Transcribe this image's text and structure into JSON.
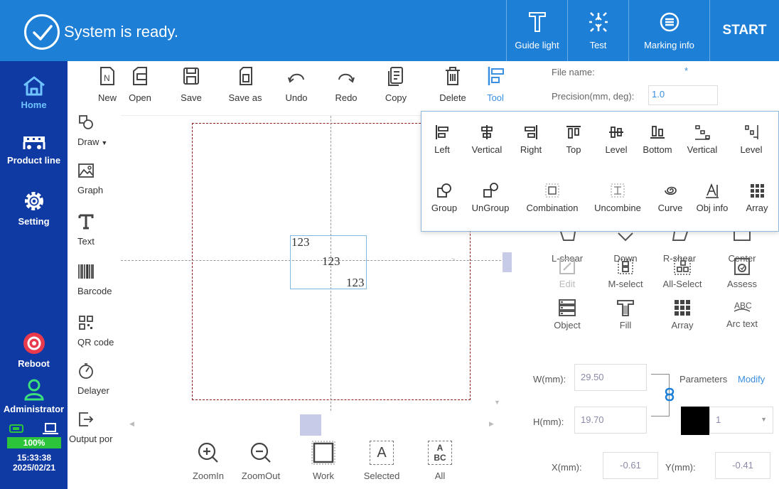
{
  "header": {
    "status_text": "System is ready.",
    "buttons": [
      {
        "label": "Guide light",
        "icon": "guide-light-icon"
      },
      {
        "label": "Test",
        "icon": "test-icon"
      },
      {
        "label": "Marking info",
        "icon": "marking-info-icon"
      }
    ],
    "start_label": "START",
    "color": "#1e7fd6"
  },
  "sidebar": {
    "color": "#0f3aa3",
    "items": [
      {
        "label": "Home",
        "icon": "home-icon"
      },
      {
        "label": "Product line",
        "icon": "product-line-icon"
      },
      {
        "label": "Setting",
        "icon": "gear-icon"
      },
      {
        "label": "Reboot",
        "icon": "reboot-icon"
      },
      {
        "label": "Administrator",
        "icon": "user-icon"
      }
    ],
    "battery": "100%",
    "time": "15:33:38",
    "date": "2025/02/21"
  },
  "toolcol": {
    "items": [
      {
        "label": "Draw",
        "icon": "draw-icon"
      },
      {
        "label": "Graph",
        "icon": "graph-icon"
      },
      {
        "label": "Text",
        "icon": "text-icon"
      },
      {
        "label": "Barcode",
        "icon": "barcode-icon"
      },
      {
        "label": "QR code",
        "icon": "qr-code-icon"
      },
      {
        "label": "Delayer",
        "icon": "delayer-icon"
      },
      {
        "label": "Output por",
        "icon": "output-port-icon"
      }
    ]
  },
  "toolbar": {
    "items": [
      {
        "label": "New",
        "icon": "new-file-icon"
      },
      {
        "label": "Open",
        "icon": "open-icon"
      },
      {
        "label": "Save",
        "icon": "save-icon"
      },
      {
        "label": "Save as",
        "icon": "save-as-icon"
      },
      {
        "label": "Undo",
        "icon": "undo-icon"
      },
      {
        "label": "Redo",
        "icon": "redo-icon"
      },
      {
        "label": "Copy",
        "icon": "copy-icon"
      },
      {
        "label": "Delete",
        "icon": "delete-icon"
      },
      {
        "label": "Tool",
        "icon": "tool-icon"
      }
    ]
  },
  "file": {
    "name_label": "File name:",
    "name_value": "*",
    "precision_label": "Precision(mm, deg):",
    "precision_value": "1.0"
  },
  "canvas": {
    "texts": [
      "123",
      "123",
      "123"
    ]
  },
  "align_popup": {
    "row1": [
      {
        "label": "Left",
        "icon": "align-left-icon"
      },
      {
        "label": "Vertical",
        "icon": "align-vertical-center-icon"
      },
      {
        "label": "Right",
        "icon": "align-right-icon"
      },
      {
        "label": "Top",
        "icon": "align-top-icon"
      },
      {
        "label": "Level",
        "icon": "align-level-center-icon"
      },
      {
        "label": "Bottom",
        "icon": "align-bottom-icon"
      },
      {
        "label": "Vertical",
        "icon": "distribute-vertical-icon"
      },
      {
        "label": "Level",
        "icon": "distribute-level-icon"
      }
    ],
    "row2": [
      {
        "label": "Group",
        "icon": "group-icon"
      },
      {
        "label": "UnGroup",
        "icon": "ungroup-icon"
      },
      {
        "label": "Combination",
        "icon": "combination-icon"
      },
      {
        "label": "Uncombine",
        "icon": "uncombine-icon"
      },
      {
        "label": "Curve",
        "icon": "curve-icon"
      },
      {
        "label": "Obj info",
        "icon": "obj-info-icon"
      },
      {
        "label": "Array",
        "icon": "array-icon"
      }
    ]
  },
  "right_panel": {
    "row1": [
      {
        "label": "L-shear"
      },
      {
        "label": "Down"
      },
      {
        "label": "R-shear"
      },
      {
        "label": "Center"
      }
    ],
    "row2": [
      {
        "label": "Edit",
        "icon": "edit-icon"
      },
      {
        "label": "M-select",
        "icon": "m-select-icon"
      },
      {
        "label": "All-Select",
        "icon": "all-select-icon"
      },
      {
        "label": "Assess",
        "icon": "assess-icon"
      }
    ],
    "row3": [
      {
        "label": "Object",
        "icon": "object-icon"
      },
      {
        "label": "Fill",
        "icon": "fill-icon"
      },
      {
        "label": "Array",
        "icon": "array-icon"
      },
      {
        "label": "Arc text",
        "icon": "arc-text-icon"
      }
    ],
    "w_label": "W(mm):",
    "w_value": "29.50",
    "h_label": "H(mm):",
    "h_value": "19.70",
    "x_label": "X(mm):",
    "x_value": "-0.61",
    "y_label": "Y(mm):",
    "y_value": "-0.41",
    "parameters_label": "Parameters",
    "modify_label": "Modify",
    "layer_value": "1"
  },
  "zoombar": {
    "items": [
      {
        "label": "ZoomIn",
        "icon": "zoom-in-icon"
      },
      {
        "label": "ZoomOut",
        "icon": "zoom-out-icon"
      },
      {
        "label": "Work",
        "icon": "work-area-icon"
      },
      {
        "label": "Selected",
        "icon": "selected-icon"
      },
      {
        "label": "All",
        "icon": "all-icon"
      }
    ],
    "selected_glyph": "A",
    "all_glyph_top": "A",
    "all_glyph_bottom": "BC"
  }
}
